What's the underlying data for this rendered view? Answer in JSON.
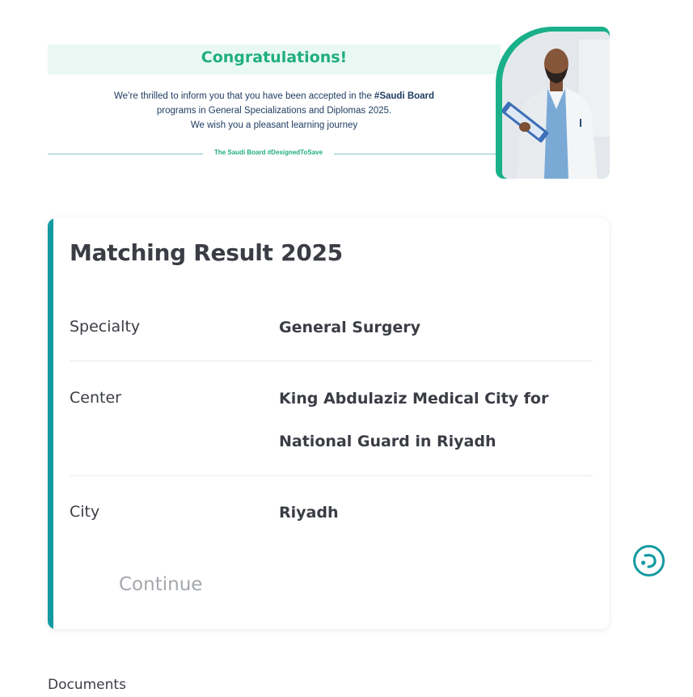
{
  "banner": {
    "title": "Congratulations!",
    "message_line1_prefix": "We’re thrilled to inform you that you have been accepted in the ",
    "message_line1_hashtag": "#Saudi Board",
    "message_line2": "programs in General Specializations and Diplomas 2025.",
    "message_line3": "We wish you a pleasant learning journey",
    "footer_tag": "The Saudi Board #DesignedToSave",
    "accent_color": "#1fae7f",
    "frame_color": "#19b08a"
  },
  "result_card": {
    "title": "Matching Result 2025",
    "accent_color": "#149aa1",
    "rows": [
      {
        "label": "Specialty",
        "value": "General Surgery"
      },
      {
        "label": "Center",
        "value": "King Abdulaziz Medical City for National Guard in Riyadh"
      },
      {
        "label": "City",
        "value": "Riyadh"
      }
    ],
    "continue_label": "Continue"
  },
  "support_button": {
    "icon": "chat-support-icon",
    "color": "#149aa1"
  },
  "documents": {
    "label": "Documents"
  }
}
